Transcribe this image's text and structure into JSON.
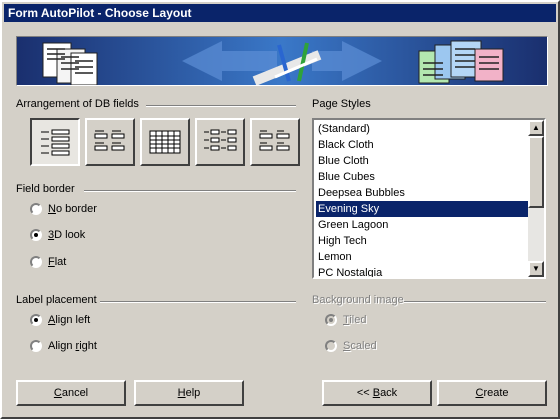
{
  "window": {
    "title": "Form AutoPilot - Choose Layout"
  },
  "arrangement": {
    "label": "Arrangement of DB fields",
    "options": [
      "Columnar - Labels Left",
      "Columnar - Labels on Top",
      "As Data Sheet",
      "In Blocks - Labels Left",
      "In Blocks - Labels Above"
    ],
    "selected_index": 0
  },
  "field_border": {
    "label": "Field border",
    "options": [
      {
        "pre": "",
        "ul": "N",
        "post": "o border",
        "checked": false
      },
      {
        "pre": "",
        "ul": "3",
        "post": "D look",
        "checked": true
      },
      {
        "pre": "",
        "ul": "F",
        "post": "lat",
        "checked": false
      }
    ]
  },
  "label_placement": {
    "label": "Label placement",
    "options": [
      {
        "pre": "",
        "ul": "A",
        "post": "lign left",
        "checked": true
      },
      {
        "pre": "Align ",
        "ul": "r",
        "post": "ight",
        "checked": false
      }
    ]
  },
  "page_styles": {
    "label": "Page Styles",
    "items": [
      "(Standard)",
      "Black Cloth",
      "Blue Cloth",
      "Blue Cubes",
      "Deepsea Bubbles",
      "Evening Sky",
      "Green Lagoon",
      "High Tech",
      "Lemon",
      "PC Nostalgia"
    ],
    "selected": "Evening Sky"
  },
  "background_image": {
    "label": "Background image",
    "options": [
      {
        "pre": "",
        "ul": "T",
        "post": "iled",
        "checked": true
      },
      {
        "pre": "",
        "ul": "S",
        "post": "caled",
        "checked": false
      }
    ]
  },
  "buttons": {
    "cancel": {
      "ul": "C",
      "post": "ancel"
    },
    "help": {
      "ul": "H",
      "post": "elp"
    },
    "back": {
      "pre": "<< ",
      "ul": "B",
      "post": "ack"
    },
    "create": {
      "ul": "C",
      "post": "reate"
    }
  },
  "colors": {
    "titlebar": "#0a246a",
    "face": "#d4d0c8",
    "selection": "#0a246a",
    "banner": "#1c3a7a"
  },
  "icons": [
    "banner-forms-icon",
    "banner-arrow-left-icon",
    "banner-arrow-right-icon",
    "banner-pencils-icon",
    "scroll-up-icon",
    "scroll-down-icon"
  ]
}
